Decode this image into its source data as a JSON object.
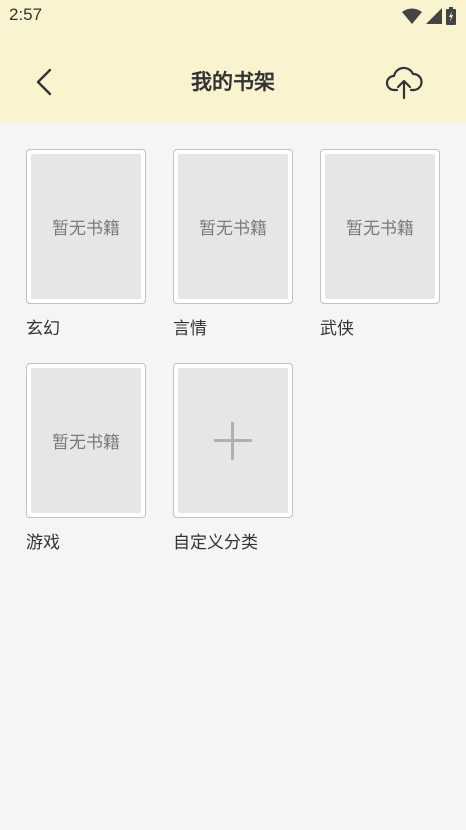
{
  "status": {
    "time": "2:57"
  },
  "header": {
    "title": "我的书架"
  },
  "shelves": [
    {
      "cover_text": "暂无书籍",
      "label": "玄幻"
    },
    {
      "cover_text": "暂无书籍",
      "label": "言情"
    },
    {
      "cover_text": "暂无书籍",
      "label": "武侠"
    },
    {
      "cover_text": "暂无书籍",
      "label": "游戏"
    }
  ],
  "add_category": {
    "label": "自定义分类"
  }
}
